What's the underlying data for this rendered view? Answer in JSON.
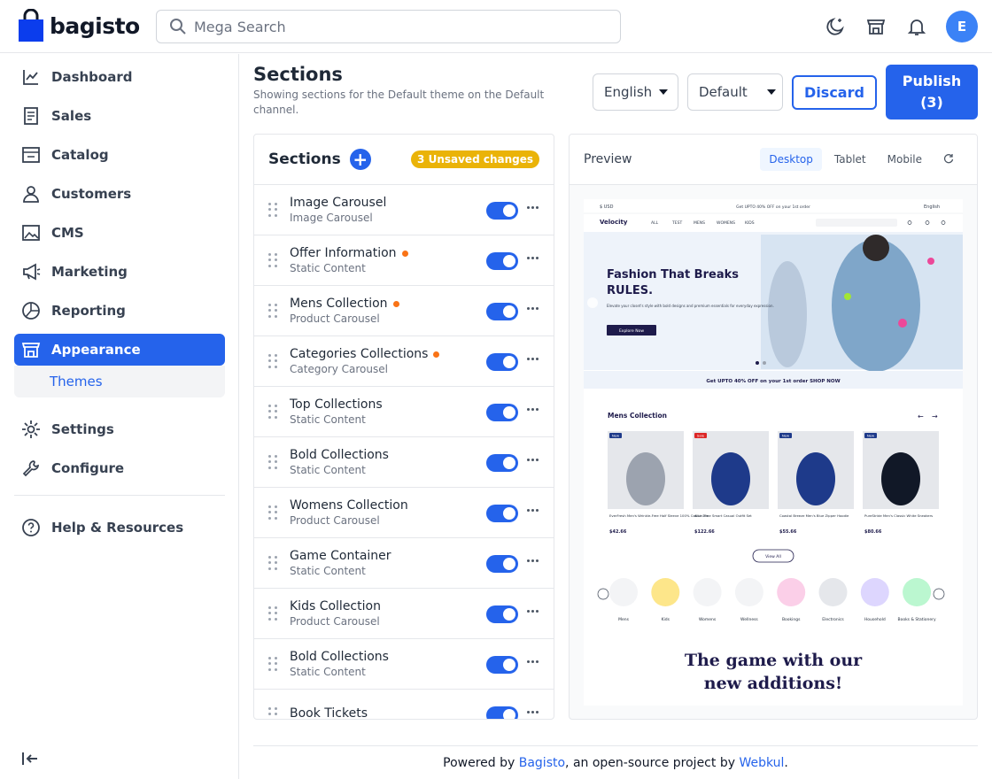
{
  "brand": {
    "name": "bagisto"
  },
  "search": {
    "placeholder": "Mega Search"
  },
  "user": {
    "initial": "E"
  },
  "sidebar": {
    "items": [
      {
        "label": "Dashboard",
        "icon": "dashboard-icon"
      },
      {
        "label": "Sales",
        "icon": "receipt-icon"
      },
      {
        "label": "Catalog",
        "icon": "catalog-icon"
      },
      {
        "label": "Customers",
        "icon": "user-icon"
      },
      {
        "label": "CMS",
        "icon": "image-icon"
      },
      {
        "label": "Marketing",
        "icon": "megaphone-icon"
      },
      {
        "label": "Reporting",
        "icon": "pie-chart-icon"
      },
      {
        "label": "Appearance",
        "icon": "store-icon"
      },
      {
        "label": "Settings",
        "icon": "gear-icon"
      },
      {
        "label": "Configure",
        "icon": "wrench-icon"
      },
      {
        "label": "Help & Resources",
        "icon": "help-icon"
      }
    ],
    "sub_item": "Themes"
  },
  "header": {
    "title": "Sections",
    "subtitle": "Showing sections for the Default theme on the Default channel.",
    "locale": "English",
    "channel": "Default",
    "discard": "Discard",
    "publish": "Publish",
    "publish_count": "(3)"
  },
  "sections_panel": {
    "title": "Sections",
    "badge": "3 Unsaved changes",
    "rows": [
      {
        "title": "Image Carousel",
        "type": "Image Carousel",
        "changed": false
      },
      {
        "title": "Offer Information",
        "type": "Static Content",
        "changed": true
      },
      {
        "title": "Mens Collection",
        "type": "Product Carousel",
        "changed": true
      },
      {
        "title": "Categories Collections",
        "type": "Category Carousel",
        "changed": true
      },
      {
        "title": "Top Collections",
        "type": "Static Content",
        "changed": false
      },
      {
        "title": "Bold Collections",
        "type": "Static Content",
        "changed": false
      },
      {
        "title": "Womens Collection",
        "type": "Product Carousel",
        "changed": false
      },
      {
        "title": "Game Container",
        "type": "Static Content",
        "changed": false
      },
      {
        "title": "Kids Collection",
        "type": "Product Carousel",
        "changed": false
      },
      {
        "title": "Bold Collections",
        "type": "Static Content",
        "changed": false
      },
      {
        "title": "Book Tickets",
        "type": "",
        "changed": false
      }
    ]
  },
  "preview": {
    "title": "Preview",
    "tabs": [
      "Desktop",
      "Tablet",
      "Mobile"
    ],
    "store": {
      "currency": "$ USD",
      "topline": "Get UPTO 40% OFF on your 1st order",
      "language": "English",
      "brand": "Velocity",
      "menu": [
        "ALL",
        "TEST",
        "MENS",
        "WOMENS",
        "KIDS"
      ],
      "hero_title": "Fashion That Breaks",
      "hero_title2": "RULES.",
      "hero_text": "Elevate your closet's style with bold designs and premium essentials for everyday expression.",
      "hero_cta": "Explore Now",
      "offer_bar": "Get UPTO 40% OFF on your 1st order SHOP NOW",
      "mens_title": "Mens Collection",
      "products": [
        {
          "badge": "New",
          "name": "EverFresh Men's Wrinkle-Free Half Sleeve 100% Cotton Tee",
          "price": "$42.66",
          "badge_color": "#1e3a8a"
        },
        {
          "badge": "Sale",
          "name": "All-in-One Smart Casual Outfit Set",
          "price": "$122.66",
          "badge_color": "#dc2626"
        },
        {
          "badge": "New",
          "name": "Coastal Breeze Men's Blue Zipper Hoodie",
          "price": "$55.66",
          "badge_color": "#1e3a8a"
        },
        {
          "badge": "New",
          "name": "PureStride Men's Classic White Sneakers",
          "price": "$80.66",
          "badge_color": "#1e3a8a"
        }
      ],
      "view_all": "View All",
      "categories": [
        "Mens",
        "Kids",
        "Womens",
        "Wellness",
        "Bookings",
        "Electronics",
        "Household",
        "Books & Stationery"
      ],
      "game_title": "The game with our",
      "game_title2": "new additions!"
    }
  },
  "footer": {
    "prefix": "Powered by",
    "link1": "Bagisto",
    "middle": ", an open-source project by",
    "link2": "Webkul",
    "suffix": "."
  },
  "colors": {
    "accent": "#2563eb",
    "badge": "#eab308",
    "changed_dot": "#f97316",
    "navy": "#1e1b4b"
  }
}
